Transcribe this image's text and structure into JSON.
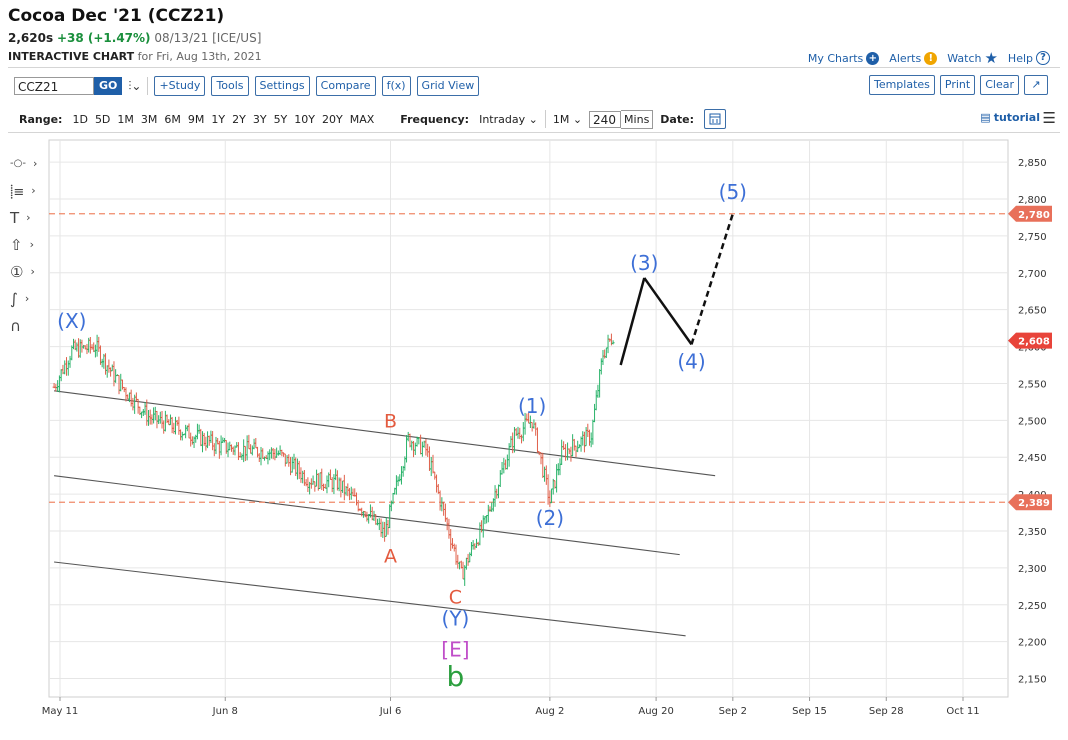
{
  "header": {
    "title": "Cocoa Dec '21 (CCZ21)",
    "price": "2,620s",
    "change": "+38 (+1.47%)",
    "meta": "08/13/21 [ICE/US]",
    "chart_label": "INTERACTIVE CHART",
    "chart_for": "for Fri, Aug 13th, 2021"
  },
  "top_links": {
    "my_charts": "My Charts",
    "alerts": "Alerts",
    "watch": "Watch",
    "help": "Help",
    "my_charts_icon": "plus-circle-icon",
    "alerts_icon": "exclamation-circle-icon",
    "watch_icon": "star-icon",
    "help_icon": "question-circle-icon"
  },
  "toolbar": {
    "symbol": "CCZ21",
    "go": "GO",
    "study": "+Study",
    "tools": "Tools",
    "settings": "Settings",
    "compare": "Compare",
    "fx": "f(x)",
    "grid_view": "Grid View",
    "templates": "Templates",
    "print": "Print",
    "clear": "Clear",
    "expand_icon": "expand-icon",
    "bar_type_icon": "candlestick-icon"
  },
  "range_bar": {
    "range_label": "Range:",
    "ranges": [
      "1D",
      "5D",
      "1M",
      "3M",
      "6M",
      "9M",
      "1Y",
      "2Y",
      "3Y",
      "5Y",
      "10Y",
      "20Y",
      "MAX"
    ],
    "frequency_label": "Frequency:",
    "frequency": "Intraday",
    "period": "1M",
    "mins_value": "240",
    "mins_label": "Mins",
    "date_label": "Date:",
    "tutorial": "tutorial"
  },
  "draw_tools": [
    "line-tool-icon",
    "fibonacci-tool-icon",
    "text-tool-icon",
    "arrow-tool-icon",
    "number-label-tool-icon",
    "curve-tool-icon",
    "magnet-icon"
  ],
  "chart_data": {
    "type": "line",
    "title": "",
    "xlabel": "",
    "ylabel": "",
    "ylim": [
      2125,
      2880
    ],
    "y_ticks": [
      2150,
      2200,
      2250,
      2300,
      2350,
      2400,
      2450,
      2500,
      2550,
      2600,
      2650,
      2700,
      2750,
      2800,
      2850
    ],
    "y_tick_labels": [
      "2,150",
      "2,200",
      "2,250",
      "2,300",
      "2,350",
      "2,400",
      "2,450",
      "2,500",
      "2,550",
      "2,600",
      "2,650",
      "2,700",
      "2,750",
      "2,800",
      "2,850"
    ],
    "x_tick_labels": [
      "May 11",
      "Jun 8",
      "Jul 6",
      "Aug 2",
      "Aug 20",
      "Sep 2",
      "Sep 15",
      "Sep 28",
      "Oct 11"
    ],
    "x_tick_dates": [
      "2021-05-11",
      "2021-06-08",
      "2021-07-06",
      "2021-08-02",
      "2021-08-20",
      "2021-09-02",
      "2021-09-15",
      "2021-09-28",
      "2021-10-11"
    ],
    "price_series": {
      "name": "CCZ21",
      "x": [
        "2021-05-10",
        "2021-05-13",
        "2021-05-17",
        "2021-05-21",
        "2021-05-26",
        "2021-06-01",
        "2021-06-07",
        "2021-06-12",
        "2021-06-17",
        "2021-06-22",
        "2021-06-27",
        "2021-07-02",
        "2021-07-05",
        "2021-07-09",
        "2021-07-12",
        "2021-07-15",
        "2021-07-18",
        "2021-07-20",
        "2021-07-22",
        "2021-07-24",
        "2021-07-27",
        "2021-07-30",
        "2021-08-02",
        "2021-08-04",
        "2021-08-05",
        "2021-08-07",
        "2021-08-09",
        "2021-08-11",
        "2021-08-13"
      ],
      "y": [
        2545,
        2595,
        2600,
        2550,
        2505,
        2485,
        2465,
        2460,
        2455,
        2420,
        2415,
        2375,
        2345,
        2475,
        2460,
        2375,
        2290,
        2330,
        2360,
        2410,
        2480,
        2500,
        2390,
        2455,
        2460,
        2470,
        2480,
        2590,
        2620
      ],
      "color_up": "#2ab36a",
      "color_down": "#e0604a"
    },
    "projection": {
      "x": [
        "2021-08-14",
        "2021-08-18",
        "2021-08-26",
        "2021-09-02"
      ],
      "y": [
        2575,
        2693,
        2603,
        2780
      ],
      "labels": [
        "",
        "(3)",
        "(4)",
        "(5)"
      ]
    },
    "h_lines": [
      {
        "value": 2780,
        "label": "2,780",
        "color": "#f08a6a"
      },
      {
        "value": 2389,
        "label": "2,389",
        "color": "#f08a6a"
      }
    ],
    "last_price": {
      "value": 2608,
      "label": "2,608",
      "color": "#e8443a"
    },
    "channel_lines": [
      {
        "x": [
          "2021-05-10",
          "2021-08-30"
        ],
        "y": [
          2540,
          2425
        ]
      },
      {
        "x": [
          "2021-05-10",
          "2021-08-24"
        ],
        "y": [
          2425,
          2318
        ]
      },
      {
        "x": [
          "2021-05-10",
          "2021-08-25"
        ],
        "y": [
          2308,
          2208
        ]
      }
    ],
    "annotations": [
      {
        "text": "(X)",
        "x": "2021-05-13",
        "y": 2625,
        "color": "#3d6fd6"
      },
      {
        "text": "B",
        "x": "2021-07-06",
        "y": 2490,
        "color": "#e35b3f"
      },
      {
        "text": "A",
        "x": "2021-07-06",
        "y": 2307,
        "color": "#e35b3f"
      },
      {
        "text": "C",
        "x": "2021-07-17",
        "y": 2252,
        "color": "#e35b3f"
      },
      {
        "text": "(Y)",
        "x": "2021-07-17",
        "y": 2222,
        "color": "#3d6fd6"
      },
      {
        "text": "[E]",
        "x": "2021-07-17",
        "y": 2180,
        "color": "#c04ec9"
      },
      {
        "text": "b",
        "x": "2021-07-17",
        "y": 2140,
        "color": "#2b9f3e"
      },
      {
        "text": "(1)",
        "x": "2021-07-30",
        "y": 2510,
        "color": "#3d6fd6"
      },
      {
        "text": "(2)",
        "x": "2021-08-02",
        "y": 2358,
        "color": "#3d6fd6"
      }
    ],
    "grid": true,
    "y_axis_position": "right"
  }
}
